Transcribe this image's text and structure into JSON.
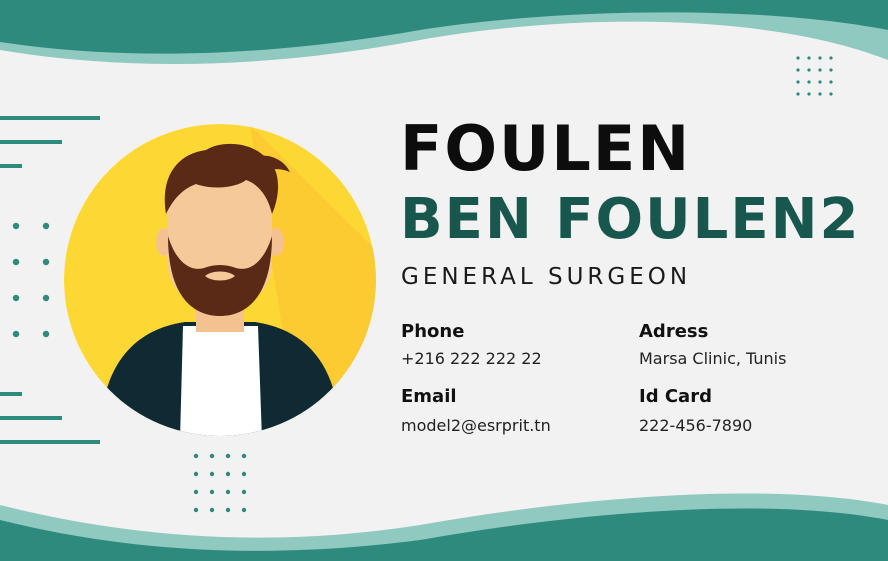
{
  "card": {
    "first_name": "FOULEN",
    "last_name": "BEN FOULEN2",
    "job_title": "GENERAL SURGEON",
    "phone": {
      "label": "Phone",
      "value": "+216 222 222 22"
    },
    "address": {
      "label": "Adress",
      "value": "Marsa Clinic, Tunis"
    },
    "email": {
      "label": "Email",
      "value": "model2@esrprit.tn"
    },
    "id_card": {
      "label": "Id Card",
      "value": "222-456-7890"
    }
  },
  "colors": {
    "teal_dark": "#18574e",
    "teal": "#2f8a7e",
    "teal_light": "#8fc9c0",
    "yellow": "#fdd835",
    "text_dark": "#0d0d0d",
    "background": "#f2f2f2"
  },
  "icons": {
    "avatar": "bearded-man-avatar-icon"
  }
}
